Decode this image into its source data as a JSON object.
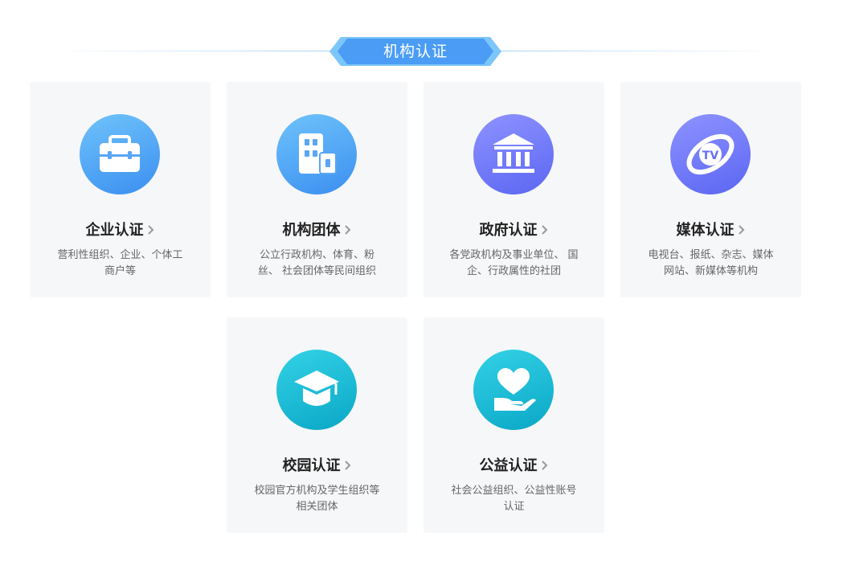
{
  "section": {
    "title": "机构认证"
  },
  "cards": [
    {
      "title": "企业认证",
      "desc": "营利性组织、企业、个体工商户等",
      "icon": "briefcase-icon"
    },
    {
      "title": "机构团体",
      "desc": "公立行政机构、体育、粉丝、 社会团体等民间组织",
      "icon": "building-icon"
    },
    {
      "title": "政府认证",
      "desc": "各党政机构及事业单位、 国企、行政属性的社团",
      "icon": "government-icon"
    },
    {
      "title": "媒体认证",
      "desc": "电视台、报纸、杂志、媒体 网站、新媒体等机构",
      "icon": "tv-icon"
    },
    {
      "title": "校园认证",
      "desc": "校园官方机构及学生组织等 相关团体",
      "icon": "graduation-cap-icon"
    },
    {
      "title": "公益认证",
      "desc": "社会公益组织、公益性账号认证",
      "icon": "heart-hand-icon"
    }
  ],
  "colors": {
    "badge": "#4a9cf5",
    "badge_edge": "#7cc6fb",
    "card_bg": "#f6f7f9",
    "blue": "#3b8ff0",
    "purple": "#5b66f3",
    "teal": "#0aa7c6"
  }
}
